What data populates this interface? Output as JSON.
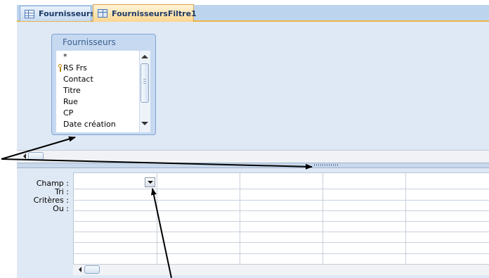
{
  "tabs": [
    {
      "label": "Fournisseurs",
      "icon": "table-icon",
      "active": false
    },
    {
      "label": "FournisseursFiltre1",
      "icon": "query-icon",
      "active": true
    }
  ],
  "field_list": {
    "title": "Fournisseurs",
    "fields": [
      "*",
      "RS Frs",
      "Contact",
      "Titre",
      "Rue",
      "CP",
      "Date création"
    ],
    "primary_key_field": "RS Frs"
  },
  "grid": {
    "row_labels": [
      "Champ :",
      "Tri :",
      "Critères :",
      "Ou :"
    ],
    "column_count": 5
  },
  "colors": {
    "tab_bar": "#bcd4ee",
    "active_tab": "#fbd68f",
    "design_area": "#dfe9f5",
    "field_box": "#c6d9f1"
  }
}
